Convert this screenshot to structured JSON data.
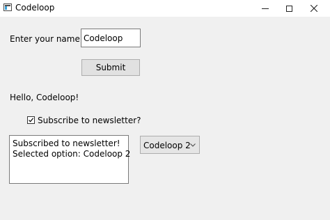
{
  "window": {
    "title": "Codeloop",
    "controls": [
      "minimize",
      "maximize",
      "close"
    ]
  },
  "form": {
    "name_label": "Enter your name:",
    "name_value": "Codeloop",
    "submit_label": "Submit",
    "greeting": "Hello, Codeloop!",
    "checkbox_label": "Subscribe to newsletter?",
    "checkbox_checked": true
  },
  "output": {
    "lines": [
      "Subscribed to newsletter!",
      "Selected option: Codeloop 2"
    ]
  },
  "combo": {
    "selected": "Codeloop 2"
  }
}
